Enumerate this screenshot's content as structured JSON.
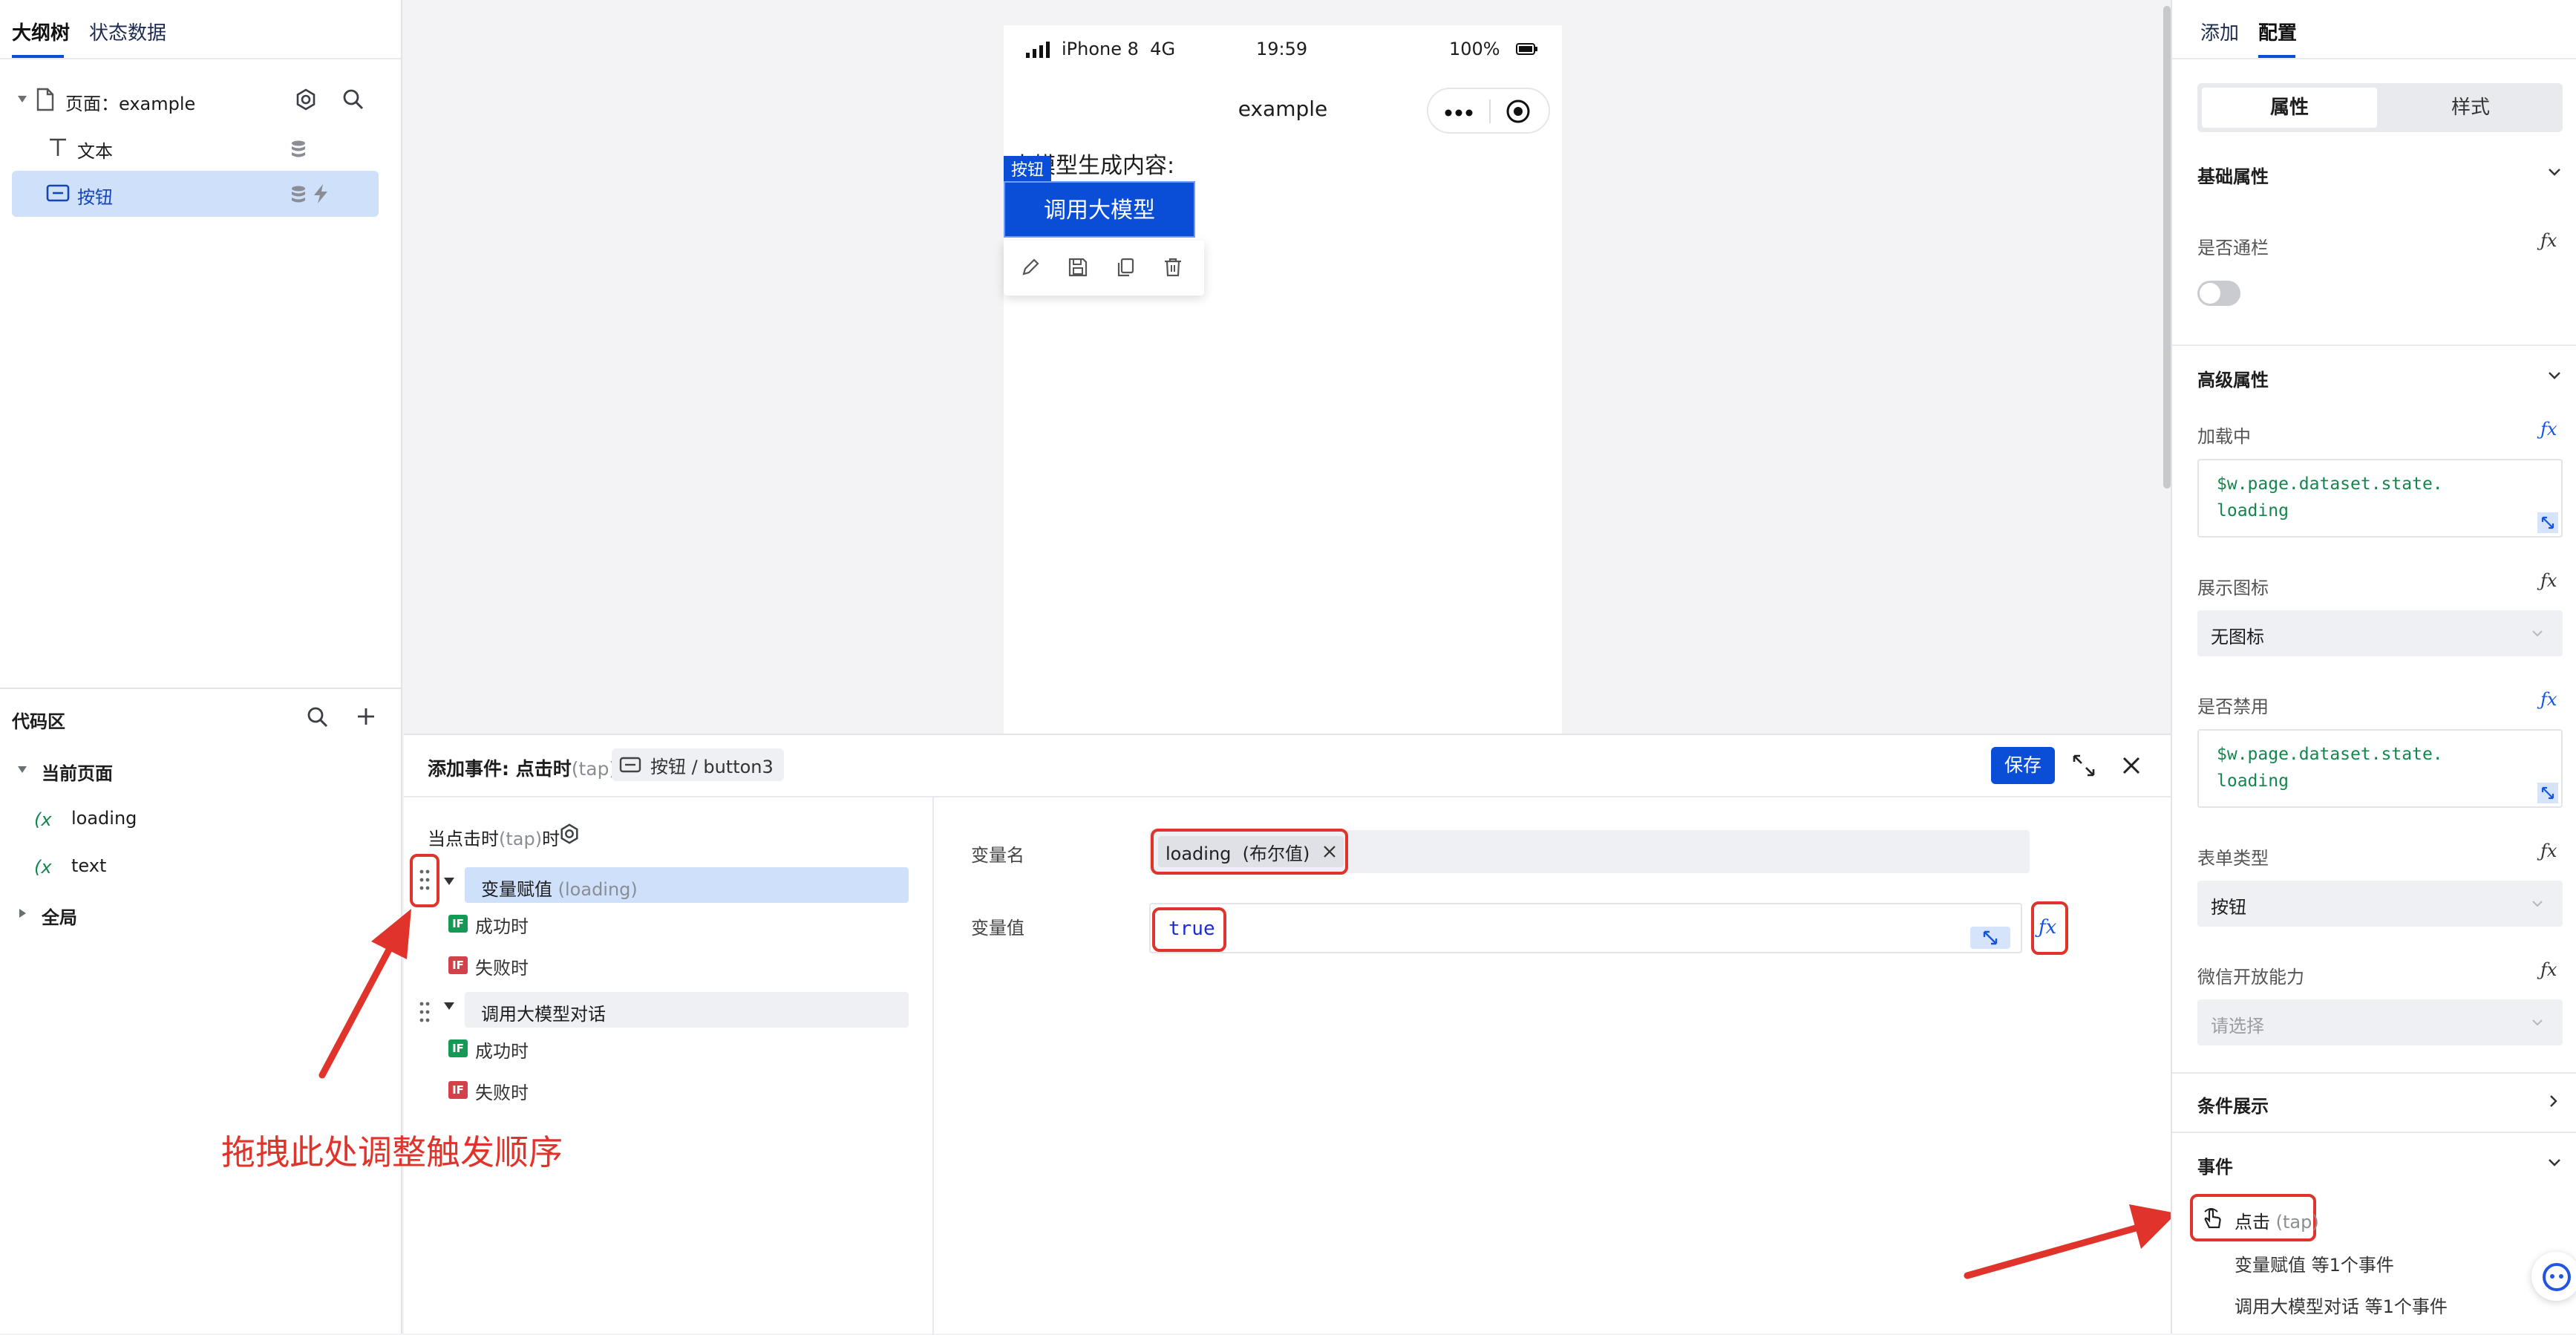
{
  "left_panel": {
    "tabs": [
      "大纲树",
      "状态数据"
    ],
    "tree": {
      "page_prefix": "页面：",
      "page_name": "example",
      "children": [
        "文本",
        "按钮"
      ]
    },
    "code_area": {
      "title": "代码区",
      "current_page": "当前页面",
      "vars": [
        "loading",
        "text"
      ],
      "global": "全局"
    }
  },
  "phone": {
    "status": {
      "carrier": "iPhone 8  4G",
      "time": "19:59",
      "battery": "100%"
    },
    "nav_title": "example",
    "content_text": "大模型生成内容:",
    "selected_tag": "按钮",
    "button_label": "调用大模型"
  },
  "event_panel": {
    "title": "添加事件: 点击时",
    "title_suffix": "(tap)",
    "breadcrumb": "按钮 / button3",
    "save_label": "保存",
    "trigger_prefix": "当点击时",
    "trigger_suffix": "(tap)",
    "trigger_end": "时",
    "actions": [
      {
        "label": "变量赋值",
        "detail": "(loading)",
        "success": "成功时",
        "fail": "失败时"
      },
      {
        "label": "调用大模型对话",
        "detail": "",
        "success": "成功时",
        "fail": "失败时"
      }
    ],
    "if_badge": "IF",
    "var_name_label": "变量名",
    "var_name_tag": "loading  (布尔值)",
    "var_value_label": "变量值",
    "var_value": "true"
  },
  "annotations": {
    "drag_hint": "拖拽此处调整触发顺序"
  },
  "right_panel": {
    "tabs": [
      "添加",
      "配置"
    ],
    "segmented": [
      "属性",
      "样式"
    ],
    "sections": {
      "basic": "基础属性",
      "advanced": "高级属性",
      "conditional": "条件展示",
      "events": "事件"
    },
    "fields": {
      "through_bar": "是否通栏",
      "loading": "加载中",
      "loading_value": "$w.page.dataset.state.\nloading",
      "show_icon": "展示图标",
      "show_icon_value": "无图标",
      "disabled": "是否禁用",
      "disabled_value": "$w.page.dataset.state.\nloading",
      "form_type": "表单类型",
      "form_type_value": "按钮",
      "wechat_ability": "微信开放能力",
      "wechat_placeholder": "请选择"
    },
    "event": {
      "name": "点击",
      "tag": "(tap)",
      "items": [
        "变量赋值 等1个事件",
        "调用大模型对话 等1个事件"
      ]
    }
  },
  "colors": {
    "primary": "#0a4ed8",
    "accent_blue": "#1454e0",
    "annotation_red": "#e0332b",
    "selected_bg": "#cfe0fb",
    "code_green": "#13864d"
  }
}
